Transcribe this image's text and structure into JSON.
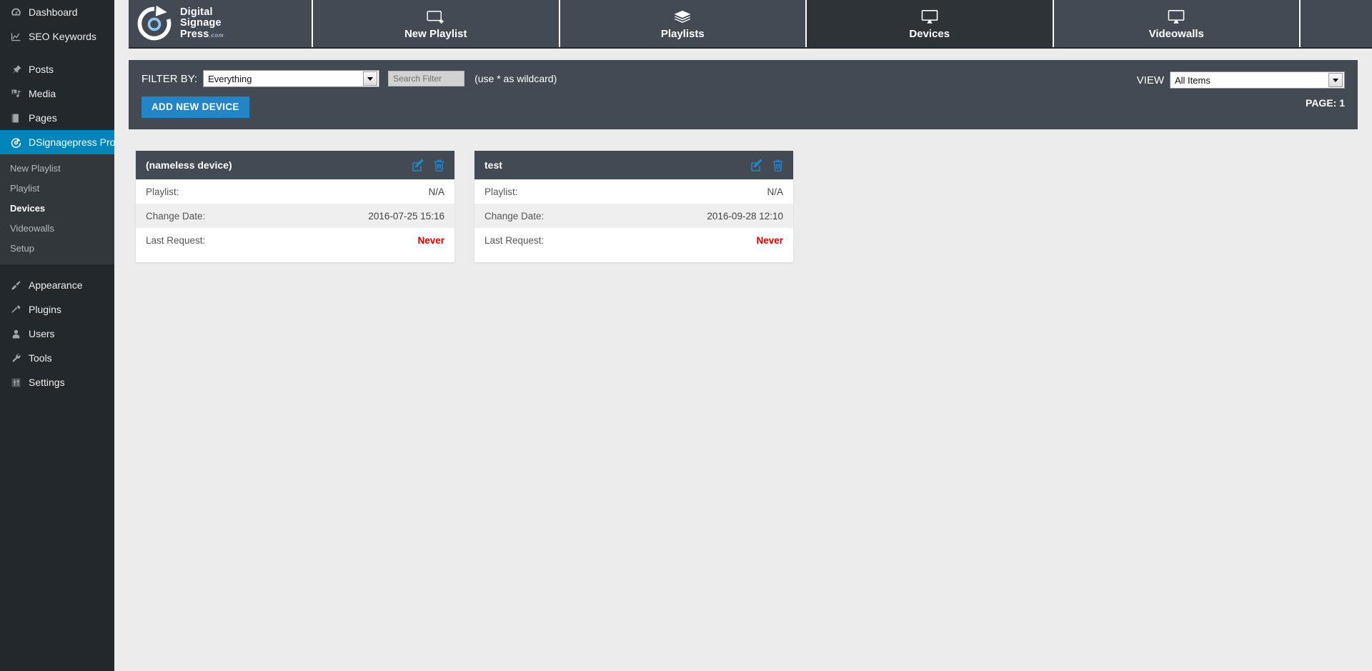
{
  "sidebar": {
    "groups": [
      {
        "items": [
          {
            "label": "Dashboard",
            "icon": "dashboard-icon",
            "name": "sidebar-item-dashboard",
            "current": false
          },
          {
            "label": "SEO Keywords",
            "icon": "chart-line-icon",
            "name": "sidebar-item-seo-keywords",
            "current": false
          }
        ]
      },
      {
        "items": [
          {
            "label": "Posts",
            "icon": "pin-icon",
            "name": "sidebar-item-posts",
            "current": false
          },
          {
            "label": "Media",
            "icon": "media-icon",
            "name": "sidebar-item-media",
            "current": false
          },
          {
            "label": "Pages",
            "icon": "page-icon",
            "name": "sidebar-item-pages",
            "current": false
          },
          {
            "label": "DSignagepress Pro",
            "icon": "refresh-circle-icon",
            "name": "sidebar-item-dsignagepress-pro",
            "current": true
          }
        ]
      },
      {
        "items": [
          {
            "label": "Appearance",
            "icon": "brush-icon",
            "name": "sidebar-item-appearance",
            "current": false
          },
          {
            "label": "Plugins",
            "icon": "plug-icon",
            "name": "sidebar-item-plugins",
            "current": false
          },
          {
            "label": "Users",
            "icon": "user-icon",
            "name": "sidebar-item-users",
            "current": false
          },
          {
            "label": "Tools",
            "icon": "wrench-icon",
            "name": "sidebar-item-tools",
            "current": false
          },
          {
            "label": "Settings",
            "icon": "sliders-icon",
            "name": "sidebar-item-settings",
            "current": false
          }
        ]
      }
    ],
    "submenu": [
      {
        "label": "New Playlist",
        "name": "submenu-item-new-playlist",
        "current": false
      },
      {
        "label": "Playlist",
        "name": "submenu-item-playlist",
        "current": false
      },
      {
        "label": "Devices",
        "name": "submenu-item-devices",
        "current": true
      },
      {
        "label": "Videowalls",
        "name": "submenu-item-videowalls",
        "current": false
      },
      {
        "label": "Setup",
        "name": "submenu-item-setup",
        "current": false
      }
    ]
  },
  "brand": {
    "line1": "Digital",
    "line2": "Signage",
    "line3": "Press",
    "suffix": ".com"
  },
  "topnav": {
    "tabs": [
      {
        "label": "New Playlist",
        "icon": "screen-plus-icon",
        "name": "tab-new-playlist",
        "active": false
      },
      {
        "label": "Playlists",
        "icon": "layers-icon",
        "name": "tab-playlists",
        "active": false
      },
      {
        "label": "Devices",
        "icon": "monitor-icon",
        "name": "tab-devices",
        "active": true
      },
      {
        "label": "Videowalls",
        "icon": "monitor-icon",
        "name": "tab-videowalls",
        "active": false
      }
    ]
  },
  "filterbar": {
    "filter_label": "FILTER BY:",
    "filter_value": "Everything",
    "search_placeholder": "Search Filter",
    "search_value": "",
    "hint": "(use * as wildcard)",
    "add_button": "ADD NEW DEVICE",
    "view_label": "VIEW",
    "view_value": "All Items",
    "page_text": "PAGE: 1"
  },
  "row_labels": {
    "playlist": "Playlist:",
    "change_date": "Change Date:",
    "last_request": "Last Request:"
  },
  "devices": [
    {
      "name": "(nameless device)",
      "playlist": "N/A",
      "change_date": "2016-07-25 15:16",
      "last_request": "Never",
      "edit_icon": "edit-pencil-icon",
      "delete_icon": "trash-icon"
    },
    {
      "name": "test",
      "playlist": "N/A",
      "change_date": "2016-09-28 12:10",
      "last_request": "Never",
      "edit_icon": "edit-pencil-icon",
      "delete_icon": "trash-icon"
    }
  ],
  "colors": {
    "accent_blue": "#2384c6",
    "sidebar_bg": "#23282d",
    "submenu_bg": "#32373c",
    "panel_bg": "#434a54",
    "active_tab_bg": "#2e3338",
    "current_menu_bg": "#0085ba",
    "danger_red": "#e00000",
    "page_bg": "#ececec"
  }
}
